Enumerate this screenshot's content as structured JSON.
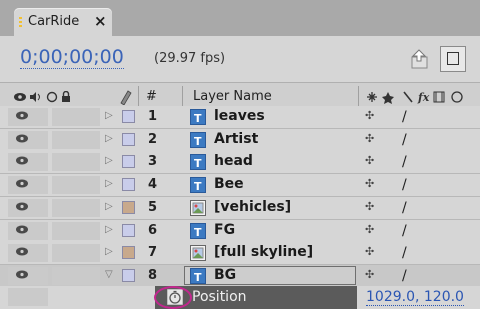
{
  "tab": {
    "title": "CarRide",
    "close": "×"
  },
  "header": {
    "timecode": "0;00;00;00",
    "fps": "(29.97 fps)"
  },
  "columns": {
    "number": "#",
    "layer_name": "Layer Name"
  },
  "layers": [
    {
      "number": "1",
      "name": "leaves",
      "type": "text",
      "label_color": "#c9cdea"
    },
    {
      "number": "2",
      "name": "Artist",
      "type": "text",
      "label_color": "#c9cdea"
    },
    {
      "number": "3",
      "name": "head",
      "type": "text",
      "label_color": "#c9cdea"
    },
    {
      "number": "4",
      "name": "Bee",
      "type": "text",
      "label_color": "#c9cdea"
    },
    {
      "number": "5",
      "name": "[vehicles]",
      "type": "footage",
      "label_color": "#c8a98c"
    },
    {
      "number": "6",
      "name": "FG",
      "type": "text",
      "label_color": "#c9cdea"
    },
    {
      "number": "7",
      "name": "[full skyline]",
      "type": "footage",
      "label_color": "#c8a98c"
    },
    {
      "number": "8",
      "name": "BG",
      "type": "text",
      "label_color": "#c9cdea",
      "expanded": true,
      "selected": true
    }
  ],
  "property": {
    "name": "Position",
    "value": "1029.0, 120.0",
    "highlight_color": "#c3278e"
  }
}
